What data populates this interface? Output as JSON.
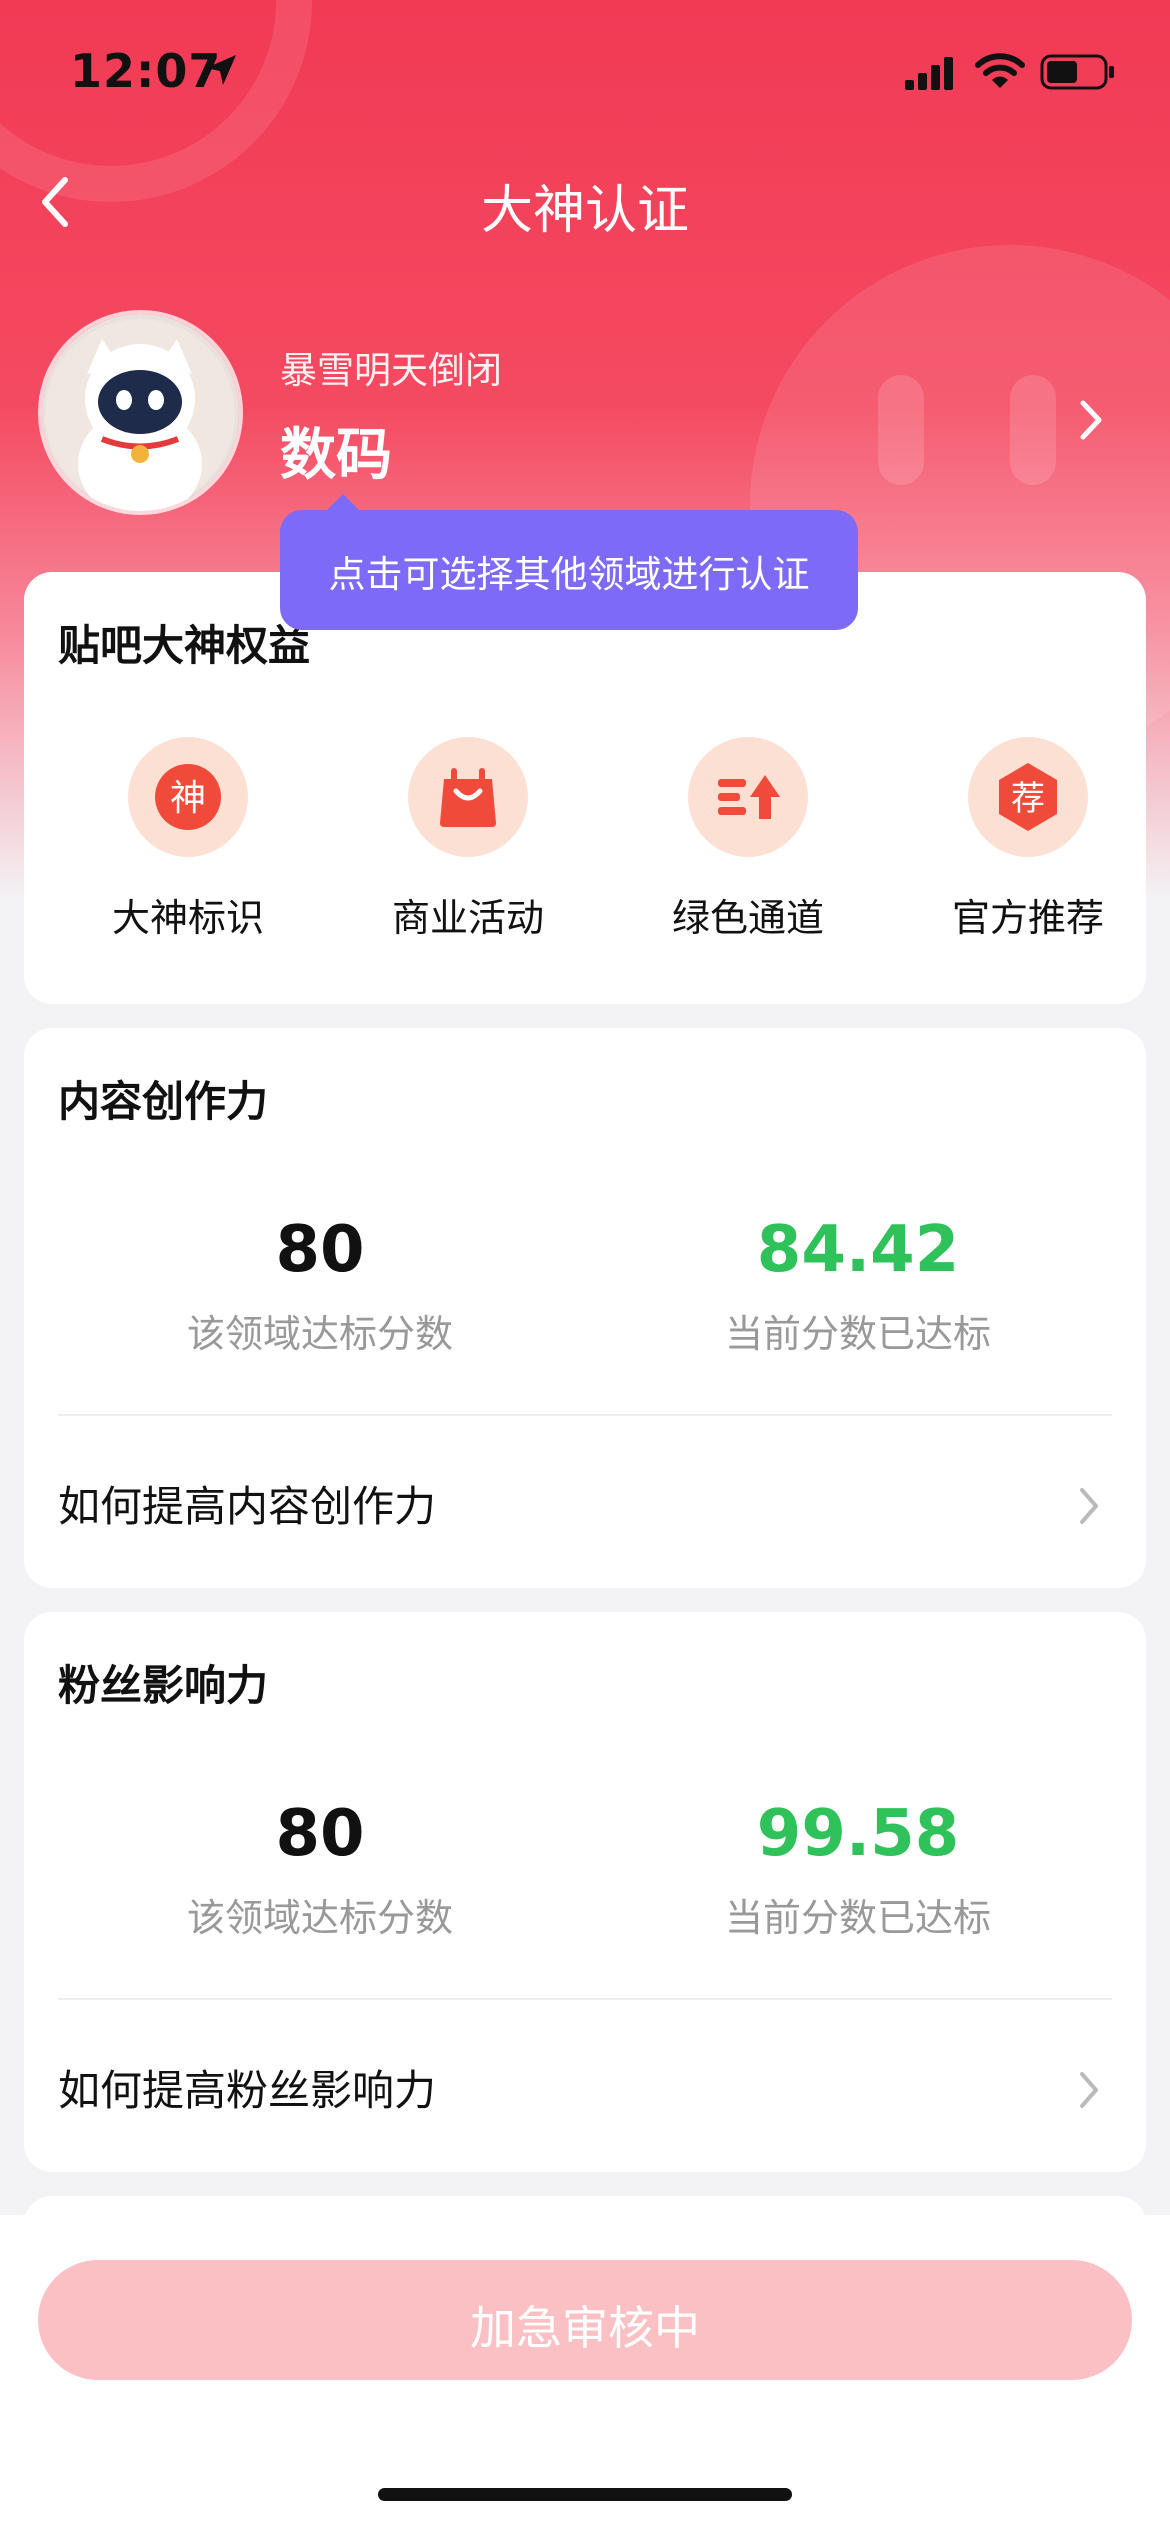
{
  "status_bar": {
    "time": "12:07"
  },
  "nav": {
    "title": "大神认证"
  },
  "profile": {
    "username": "暴雪明天倒闭",
    "domain": "数码"
  },
  "tooltip": {
    "text": "点击可选择其他领域进行认证"
  },
  "benefits": {
    "title": "贴吧大神权益",
    "items": [
      {
        "label": "大神标识",
        "icon": "shen-badge-icon",
        "glyph": "神"
      },
      {
        "label": "商业活动",
        "icon": "shopping-bag-icon"
      },
      {
        "label": "绿色通道",
        "icon": "fast-track-icon"
      },
      {
        "label": "官方推荐",
        "icon": "recommend-badge-icon",
        "glyph": "荐"
      }
    ]
  },
  "content_creation": {
    "title": "内容创作力",
    "target_score": "80",
    "target_label": "该领域达标分数",
    "current_score": "84.42",
    "current_label": "当前分数已达标",
    "link": "如何提高内容创作力"
  },
  "fan_influence": {
    "title": "粉丝影响力",
    "target_score": "80",
    "target_label": "该领域达标分数",
    "current_score": "99.58",
    "current_label": "当前分数已达标",
    "link": "如何提高粉丝影响力"
  },
  "bottom": {
    "button_label": "加急审核中"
  },
  "colors": {
    "header_red": "#f23a55",
    "tooltip_purple": "#7d6af7",
    "score_green": "#2fc15a",
    "button_pink": "#fbc0c3",
    "icon_bg": "#fde0d4",
    "icon_red": "#f04a3a"
  }
}
